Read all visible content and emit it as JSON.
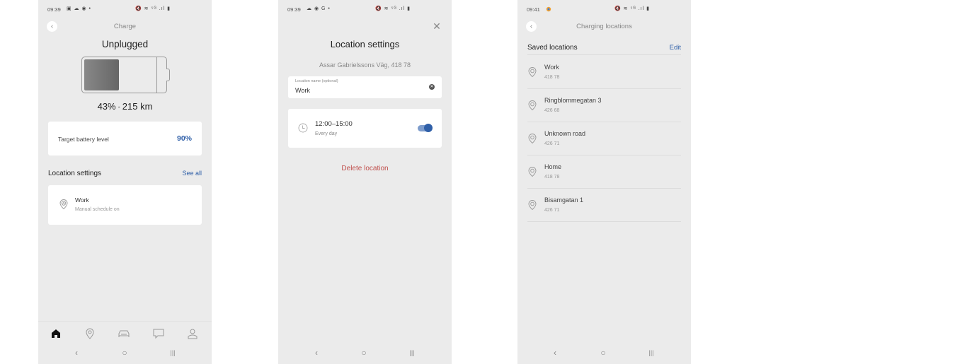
{
  "phones": [
    {
      "status_bar": {
        "time": "09:39",
        "left_icons": "▣ ☁ ◉ •",
        "right_icons": "🔇 ≋ ⁵ᴳ .ıl ▮"
      },
      "title": "Charge",
      "charge_status": "Unplugged",
      "battery_percent": "43%",
      "battery_level": 0.43,
      "range": "215 km",
      "separator": "•",
      "target": {
        "label": "Target battery level",
        "value": "90%"
      },
      "location_section": {
        "title": "Location settings",
        "link": "See all"
      },
      "location_card": {
        "name": "Work",
        "subtitle": "Manual schedule on"
      },
      "tabs": [
        {
          "icon": "home-icon",
          "active": true
        },
        {
          "icon": "location-icon",
          "active": false
        },
        {
          "icon": "car-icon",
          "active": false
        },
        {
          "icon": "chat-icon",
          "active": false
        },
        {
          "icon": "profile-icon",
          "active": false
        }
      ],
      "nav": {
        "back": "‹",
        "home": "○",
        "recents": "|||"
      }
    },
    {
      "status_bar": {
        "time": "09:39",
        "left_icons": "☁ ◉ G •",
        "right_icons": "🔇 ≋ ⁵ᴳ .ıl ▮"
      },
      "title": "Location settings",
      "close": "✕",
      "address": "Assar Gabrielssons Väg, 418 78",
      "input": {
        "label": "Location name (optional)",
        "value": "Work",
        "clear": "✕"
      },
      "schedule": {
        "time": "12:00–15:00",
        "days": "Every day",
        "enabled": true
      },
      "delete_label": "Delete location",
      "nav": {
        "back": "‹",
        "home": "○",
        "recents": "|||"
      }
    },
    {
      "status_bar": {
        "time": "09:41",
        "left_icons": "",
        "right_icons": "🔇 ≋ ⁵ᴳ .ıl ▮"
      },
      "title": "Charging locations",
      "saved_header": {
        "title": "Saved locations",
        "link": "Edit"
      },
      "locations": [
        {
          "name": "Work",
          "code": "418 78"
        },
        {
          "name": "Ringblommegatan 3",
          "code": "426 68"
        },
        {
          "name": "Unknown road",
          "code": "426 71"
        },
        {
          "name": "Home",
          "code": "418 78"
        },
        {
          "name": "Bisamgatan 1",
          "code": "426 71"
        }
      ],
      "nav": {
        "back": "‹",
        "home": "○",
        "recents": "|||"
      }
    }
  ],
  "colors": {
    "accent": "#2f5fa8",
    "danger": "#c0504d",
    "background": "#ebebeb",
    "card": "#ffffff"
  }
}
